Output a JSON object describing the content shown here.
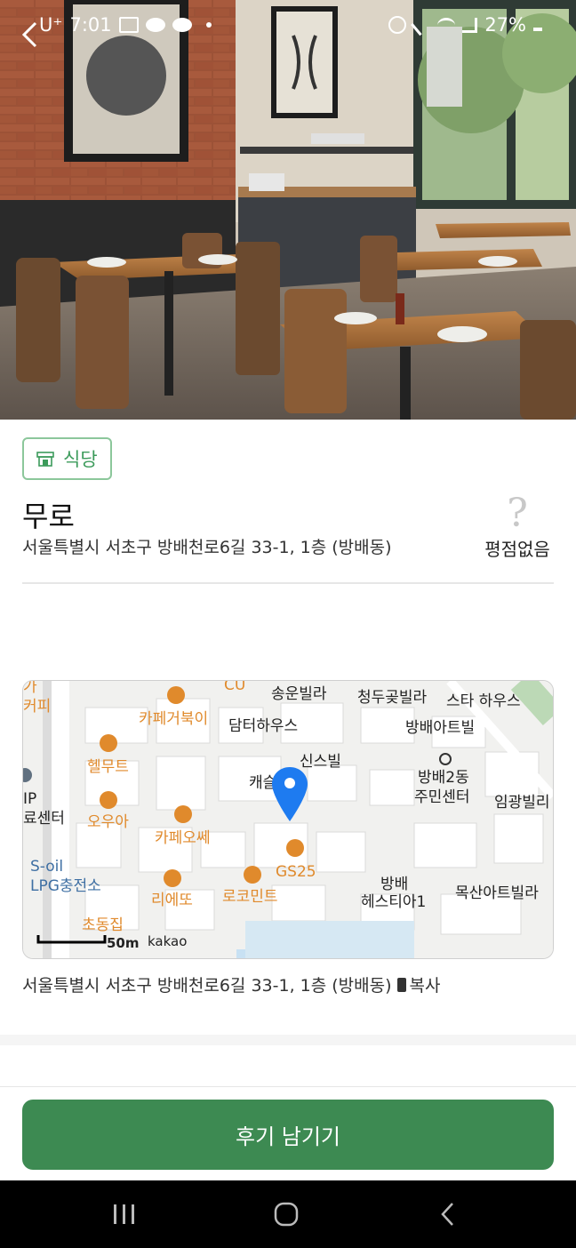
{
  "status": {
    "carrier": "U⁺",
    "time": "7:01",
    "battery": "27%"
  },
  "category": {
    "label": "식당",
    "icon": "store-icon"
  },
  "place": {
    "name": "무로",
    "address": "서울특별시 서초구 방배천로6길 33-1, 1층 (방배동)"
  },
  "rating": {
    "text": "평점없음",
    "icon": "question-mark-icon"
  },
  "map": {
    "labels": [
      "가",
      "커피",
      "CU",
      "송운빌라",
      "청두곶빌라",
      "스타 하우스",
      "카페거북이",
      "담터하우스",
      "방배아트빌",
      "헬무트",
      "신스빌",
      "방배2동",
      "주민센터",
      "IP",
      "료센터",
      "오우아",
      "캐슬",
      "임광빌리",
      "카페오쎄",
      "S-oil",
      "LPG충전소",
      "GS25",
      "리에또",
      "로코민트",
      "방배",
      "헤스티아1",
      "목산아트빌라",
      "초동집",
      "50m",
      "kakao"
    ]
  },
  "map_address": "서울특별시 서초구 방배천로6길 33-1, 1층 (방배동)",
  "copy_label": "복사",
  "review_button": "후기 남기기",
  "colors": {
    "accent": "#3d8a52",
    "badge": "#3c9b5b",
    "pin": "#1e7bf0",
    "poi": "#e08a2c"
  }
}
